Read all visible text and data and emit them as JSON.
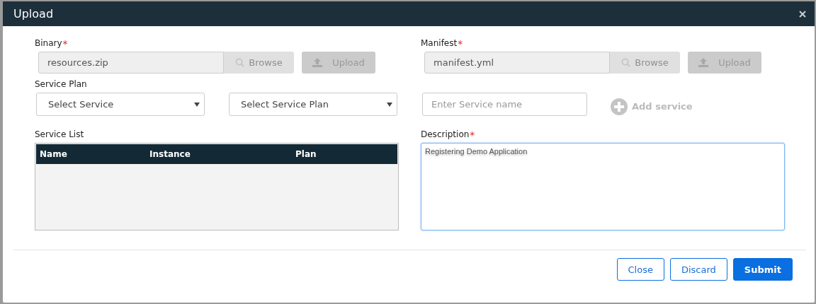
{
  "dialog": {
    "title": "Upload"
  },
  "files": [
    {
      "label": "Binary",
      "required_mark": "*",
      "value": "resources.zip",
      "browse": {
        "label": "Browse",
        "disabled": true
      },
      "upload": {
        "label": "Upload",
        "disabled": true
      }
    },
    {
      "label": "Manifest",
      "required_mark": "*",
      "value": "manifest.yml",
      "browse": {
        "label": "Browse",
        "disabled": true
      },
      "upload": {
        "label": "Upload",
        "disabled": true
      }
    }
  ],
  "service_plan": {
    "label": "Service Plan",
    "selects": [
      "Select Service",
      "Select Service Plan"
    ],
    "name_field": {
      "placeholder": "Enter Service name"
    },
    "add": {
      "label": "Add service",
      "disabled": true
    }
  },
  "service_list": {
    "label": "Service List",
    "columns": [
      "Name",
      "Instance",
      "Plan"
    ]
  },
  "description": {
    "label": "Description",
    "required_mark": "*",
    "value": "Registering Demo Application",
    "focused": true
  },
  "footer": {
    "buttons": [
      {
        "label": "Close",
        "kind": "outline"
      },
      {
        "label": "Discard",
        "kind": "outline"
      },
      {
        "label": "Submit",
        "kind": "primary"
      }
    ]
  }
}
